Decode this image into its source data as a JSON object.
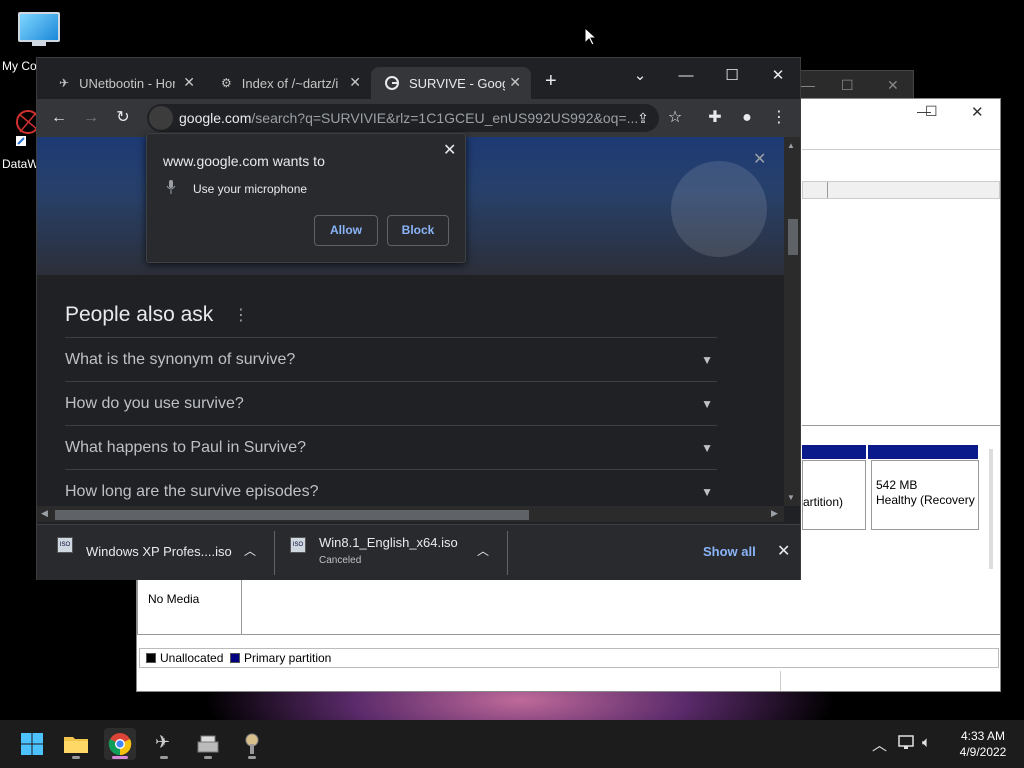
{
  "desktop": {
    "icons": [
      {
        "label": "My Co"
      },
      {
        "label": "DataW"
      }
    ]
  },
  "disk_mgmt": {
    "partition_label": "artition)",
    "recovery_size": "542 MB",
    "recovery_status": "Healthy (Recovery",
    "cdrom_status": "No Media",
    "legend": {
      "unallocated": "Unallocated",
      "primary": "Primary partition"
    },
    "legend_colors": {
      "unallocated": "#000000",
      "primary": "#000080"
    }
  },
  "chrome": {
    "tabs": [
      {
        "title": "UNetbootin - Hom",
        "active": false
      },
      {
        "title": "Index of /~dartz/is",
        "active": false
      },
      {
        "title": "SURVIVE - Google",
        "active": true
      }
    ],
    "new_tab_label": "+",
    "omnibox": {
      "host": "google.com",
      "rest": "/search?q=SURVIVIE&rlz=1C1GCEU_enUS992US992&oq=..."
    },
    "permission": {
      "title": "www.google.com wants to",
      "request": "Use your microphone",
      "allow": "Allow",
      "block": "Block"
    },
    "people_also_ask": {
      "title": "People also ask",
      "questions": [
        "What is the synonym of survive?",
        "How do you use survive?",
        "What happens to Paul in Survive?",
        "How long are the survive episodes?"
      ]
    },
    "downloads": [
      {
        "name": "Windows XP Profes....iso",
        "status": ""
      },
      {
        "name": "Win8.1_English_x64.iso",
        "status": "Canceled"
      }
    ],
    "show_all": "Show all"
  },
  "taskbar": {
    "clock_time": "4:33 AM",
    "clock_date": "4/9/2022"
  },
  "colors": {
    "chrome_bg": "#202124",
    "link_blue": "#8ab4f8",
    "accent_pink": "#d58ad5"
  }
}
